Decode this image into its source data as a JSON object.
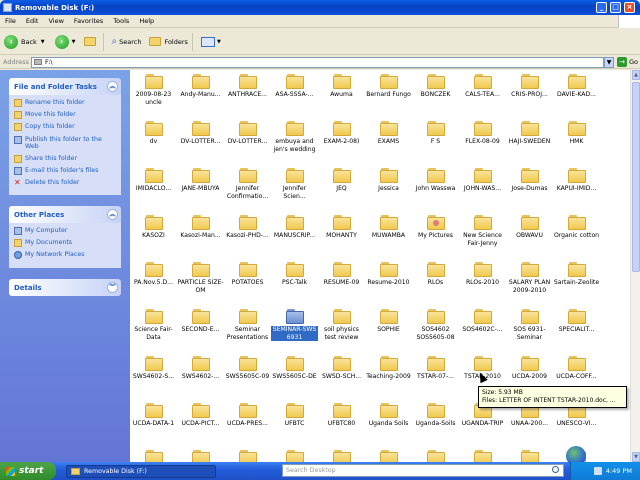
{
  "window": {
    "title": "Removable Disk (F:)"
  },
  "menu": [
    "File",
    "Edit",
    "View",
    "Favorites",
    "Tools",
    "Help"
  ],
  "toolbar": {
    "back": "Back",
    "search": "Search",
    "folders": "Folders"
  },
  "address": {
    "label": "Address",
    "value": "F:\\",
    "go": "Go"
  },
  "tasks": {
    "title": "File and Folder Tasks",
    "items": [
      "Rename this folder",
      "Move this folder",
      "Copy this folder",
      "Publish this folder to the Web",
      "Share this folder",
      "E-mail this folder's files",
      "Delete this folder"
    ]
  },
  "other_places": {
    "title": "Other Places",
    "items": [
      "My Computer",
      "My Documents",
      "My Network Places"
    ]
  },
  "details": {
    "title": "Details"
  },
  "folders": [
    [
      "2009-08-23 uncle",
      "Andy-Manu...",
      "ANTHRACE...",
      "ASA-SSSA-...",
      "Awuma",
      "Bernard Fungo",
      "BONCZEK",
      "CALS-TEA...",
      "CRIS-PROJ...",
      "DAVIE-KAD..."
    ],
    [
      "dv",
      "DV-LOTTER...",
      "DV-LOTTER...",
      "embuya and jen's wedding",
      "EXAM-2-08)",
      "EXAMS",
      "F S",
      "FLEX-08-09",
      "HAJI-SWEDEN",
      "HMK"
    ],
    [
      "IMIDACLO...",
      "JANE-MBUYA",
      "Jennifer Confirmatio...",
      "Jennifer Scien...",
      "JEQ",
      "Jessica",
      "John Wasswa",
      "JOHN-WAS...",
      "Jose-Dumas",
      "KAPUI-IMID..."
    ],
    [
      "KASOZI",
      "Kasozi-Man...",
      "Kasozi-PHD-...",
      "MANUSCRIP...",
      "MOHANTY",
      "MUWAMBA",
      "My Pictures",
      "New Science Fair-Jenny",
      "OBWAVU",
      "Organic cotton"
    ],
    [
      "PA.Nov.5.D...",
      "PARTICLE SIZE-OM",
      "POTATOES",
      "PSC-Talk",
      "RESUME-09",
      "Resume-2010",
      "RLOs",
      "RLOs-2010",
      "SALARY PLAN 2009-2010",
      "Sartain-Zeolite"
    ],
    [
      "Science Fair-Data",
      "SECOND-E...",
      "Seminar Presentations",
      "SEMINAR-SWS 6931",
      "soil physics test review",
      "SOPHIE",
      "SOS4602 SOS5605-08",
      "SOS4602C-...",
      "SOS 6931-Seminar",
      "SPECIALIT..."
    ],
    [
      "SWS4602-S...",
      "SWS4602-...",
      "SWS5605C-09",
      "SWS5605C-DE",
      "SWSD-SCH...",
      "Teaching-2009",
      "TSTAR-07-...",
      "TSTAR-2010",
      "UCDA-2009",
      "UCDA-COFF..."
    ],
    [
      "UCDA-DATA-1",
      "UCDA-PICT...",
      "UCDA-PRES...",
      "UFBTC",
      "UFBTC80",
      "Uganda Soils",
      "Uganda-Soils",
      "UGANDA-TRIP",
      "UNAA-200...",
      "UNESCO-VI..."
    ],
    [
      "",
      "",
      "",
      "",
      "",
      "",
      "",
      "",
      "",
      ""
    ]
  ],
  "tooltip": {
    "line1": "Size: 5.93 MB",
    "line2": "Files: LETTER OF INTENT TSTAR-2010.doc, ..."
  },
  "taskbar": {
    "start": "start",
    "task": "Removable Disk (F:)",
    "search": "Search Desktop",
    "clock": "4:49 PM"
  }
}
